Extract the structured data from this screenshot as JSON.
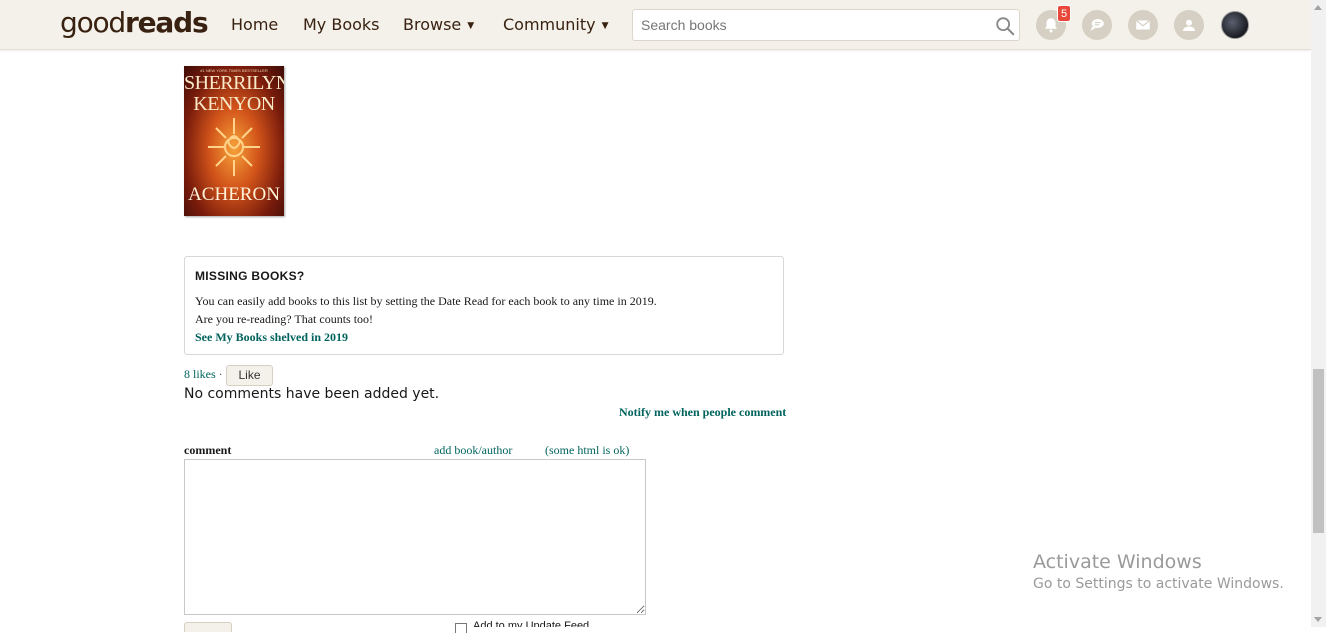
{
  "header": {
    "logo_light": "good",
    "logo_bold": "reads",
    "nav": {
      "home": "Home",
      "my_books": "My Books",
      "browse": "Browse",
      "community": "Community"
    },
    "search_placeholder": "Search books",
    "notifications_count": "5"
  },
  "book": {
    "author_line1": "SHERRILYN",
    "author_line2": "KENYON",
    "title": "ACHERON",
    "tagline": "#1 NEW YORK TIMES BESTSELLER"
  },
  "missing_books": {
    "heading": "MISSING BOOKS?",
    "line1": "You can easily add books to this list by setting the Date Read for each book to any time in 2019.",
    "line2": "Are you re-reading? That counts too!",
    "link": "See My Books shelved in 2019"
  },
  "likes": {
    "count_text": "8 likes",
    "separator": "·",
    "like_button": "Like"
  },
  "comments": {
    "empty_text": "No comments have been added yet.",
    "notify_link": "Notify me when people comment",
    "label": "comment",
    "add_book_link": "add book/author",
    "html_ok": "(some html is ok)",
    "update_feed_label": "Add to my Update Feed"
  },
  "watermark": {
    "line1": "Activate Windows",
    "line2": "Go to Settings to activate Windows."
  }
}
